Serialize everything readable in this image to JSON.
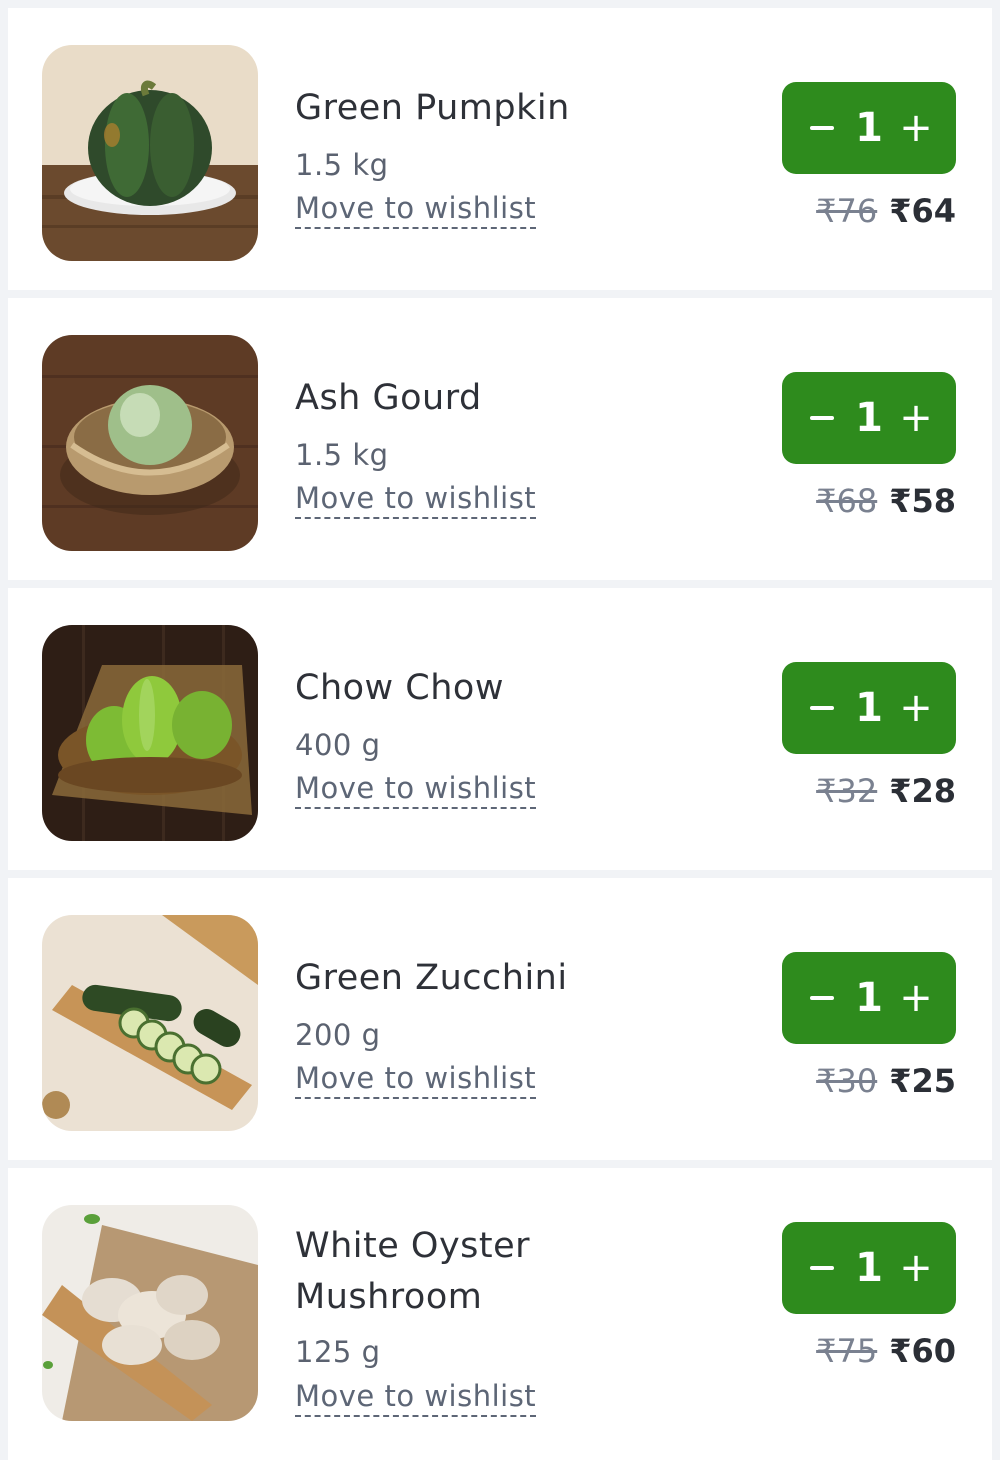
{
  "cart": {
    "items": [
      {
        "name": "Green Pumpkin",
        "weight": "1.5 kg",
        "wishlist_label": "Move to wishlist",
        "quantity": "1",
        "mrp": "₹76",
        "price": "₹64",
        "image_icon": "pumpkin-image"
      },
      {
        "name": "Ash Gourd",
        "weight": "1.5 kg",
        "wishlist_label": "Move to wishlist",
        "quantity": "1",
        "mrp": "₹68",
        "price": "₹58",
        "image_icon": "ash-gourd-image"
      },
      {
        "name": "Chow Chow",
        "weight": "400 g",
        "wishlist_label": "Move to wishlist",
        "quantity": "1",
        "mrp": "₹32",
        "price": "₹28",
        "image_icon": "chow-chow-image"
      },
      {
        "name": "Green Zucchini",
        "weight": "200 g",
        "wishlist_label": "Move to wishlist",
        "quantity": "1",
        "mrp": "₹30",
        "price": "₹25",
        "image_icon": "zucchini-image"
      },
      {
        "name": "White Oyster Mushroom",
        "weight": "125 g",
        "wishlist_label": "Move to wishlist",
        "quantity": "1",
        "mrp": "₹75",
        "price": "₹60",
        "image_icon": "oyster-mushroom-image"
      }
    ]
  },
  "colors": {
    "accent": "#2e8b1d",
    "background": "#f1f3f6",
    "card": "#ffffff"
  }
}
